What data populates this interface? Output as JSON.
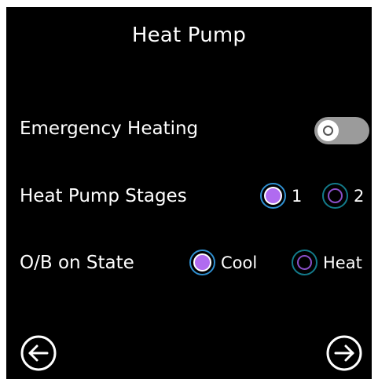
{
  "title": "Heat Pump",
  "emergency_heating": {
    "label": "Emergency Heating",
    "enabled": false
  },
  "heat_pump_stages": {
    "label": "Heat Pump Stages",
    "options": [
      {
        "label": "1",
        "selected": true
      },
      {
        "label": "2",
        "selected": false
      }
    ]
  },
  "ob_on_state": {
    "label": "O/B on State",
    "options": [
      {
        "label": "Cool",
        "selected": true
      },
      {
        "label": "Heat",
        "selected": false
      }
    ]
  },
  "navigation": {
    "back_icon": "arrow-left-circle-icon",
    "next_icon": "arrow-right-circle-icon"
  },
  "colors": {
    "background": "#000000",
    "text": "#ffffff",
    "toggle_off": "#9b9b9b",
    "radio_selected_fill": "#b06bf0",
    "radio_ring": "#1f8fb8"
  }
}
